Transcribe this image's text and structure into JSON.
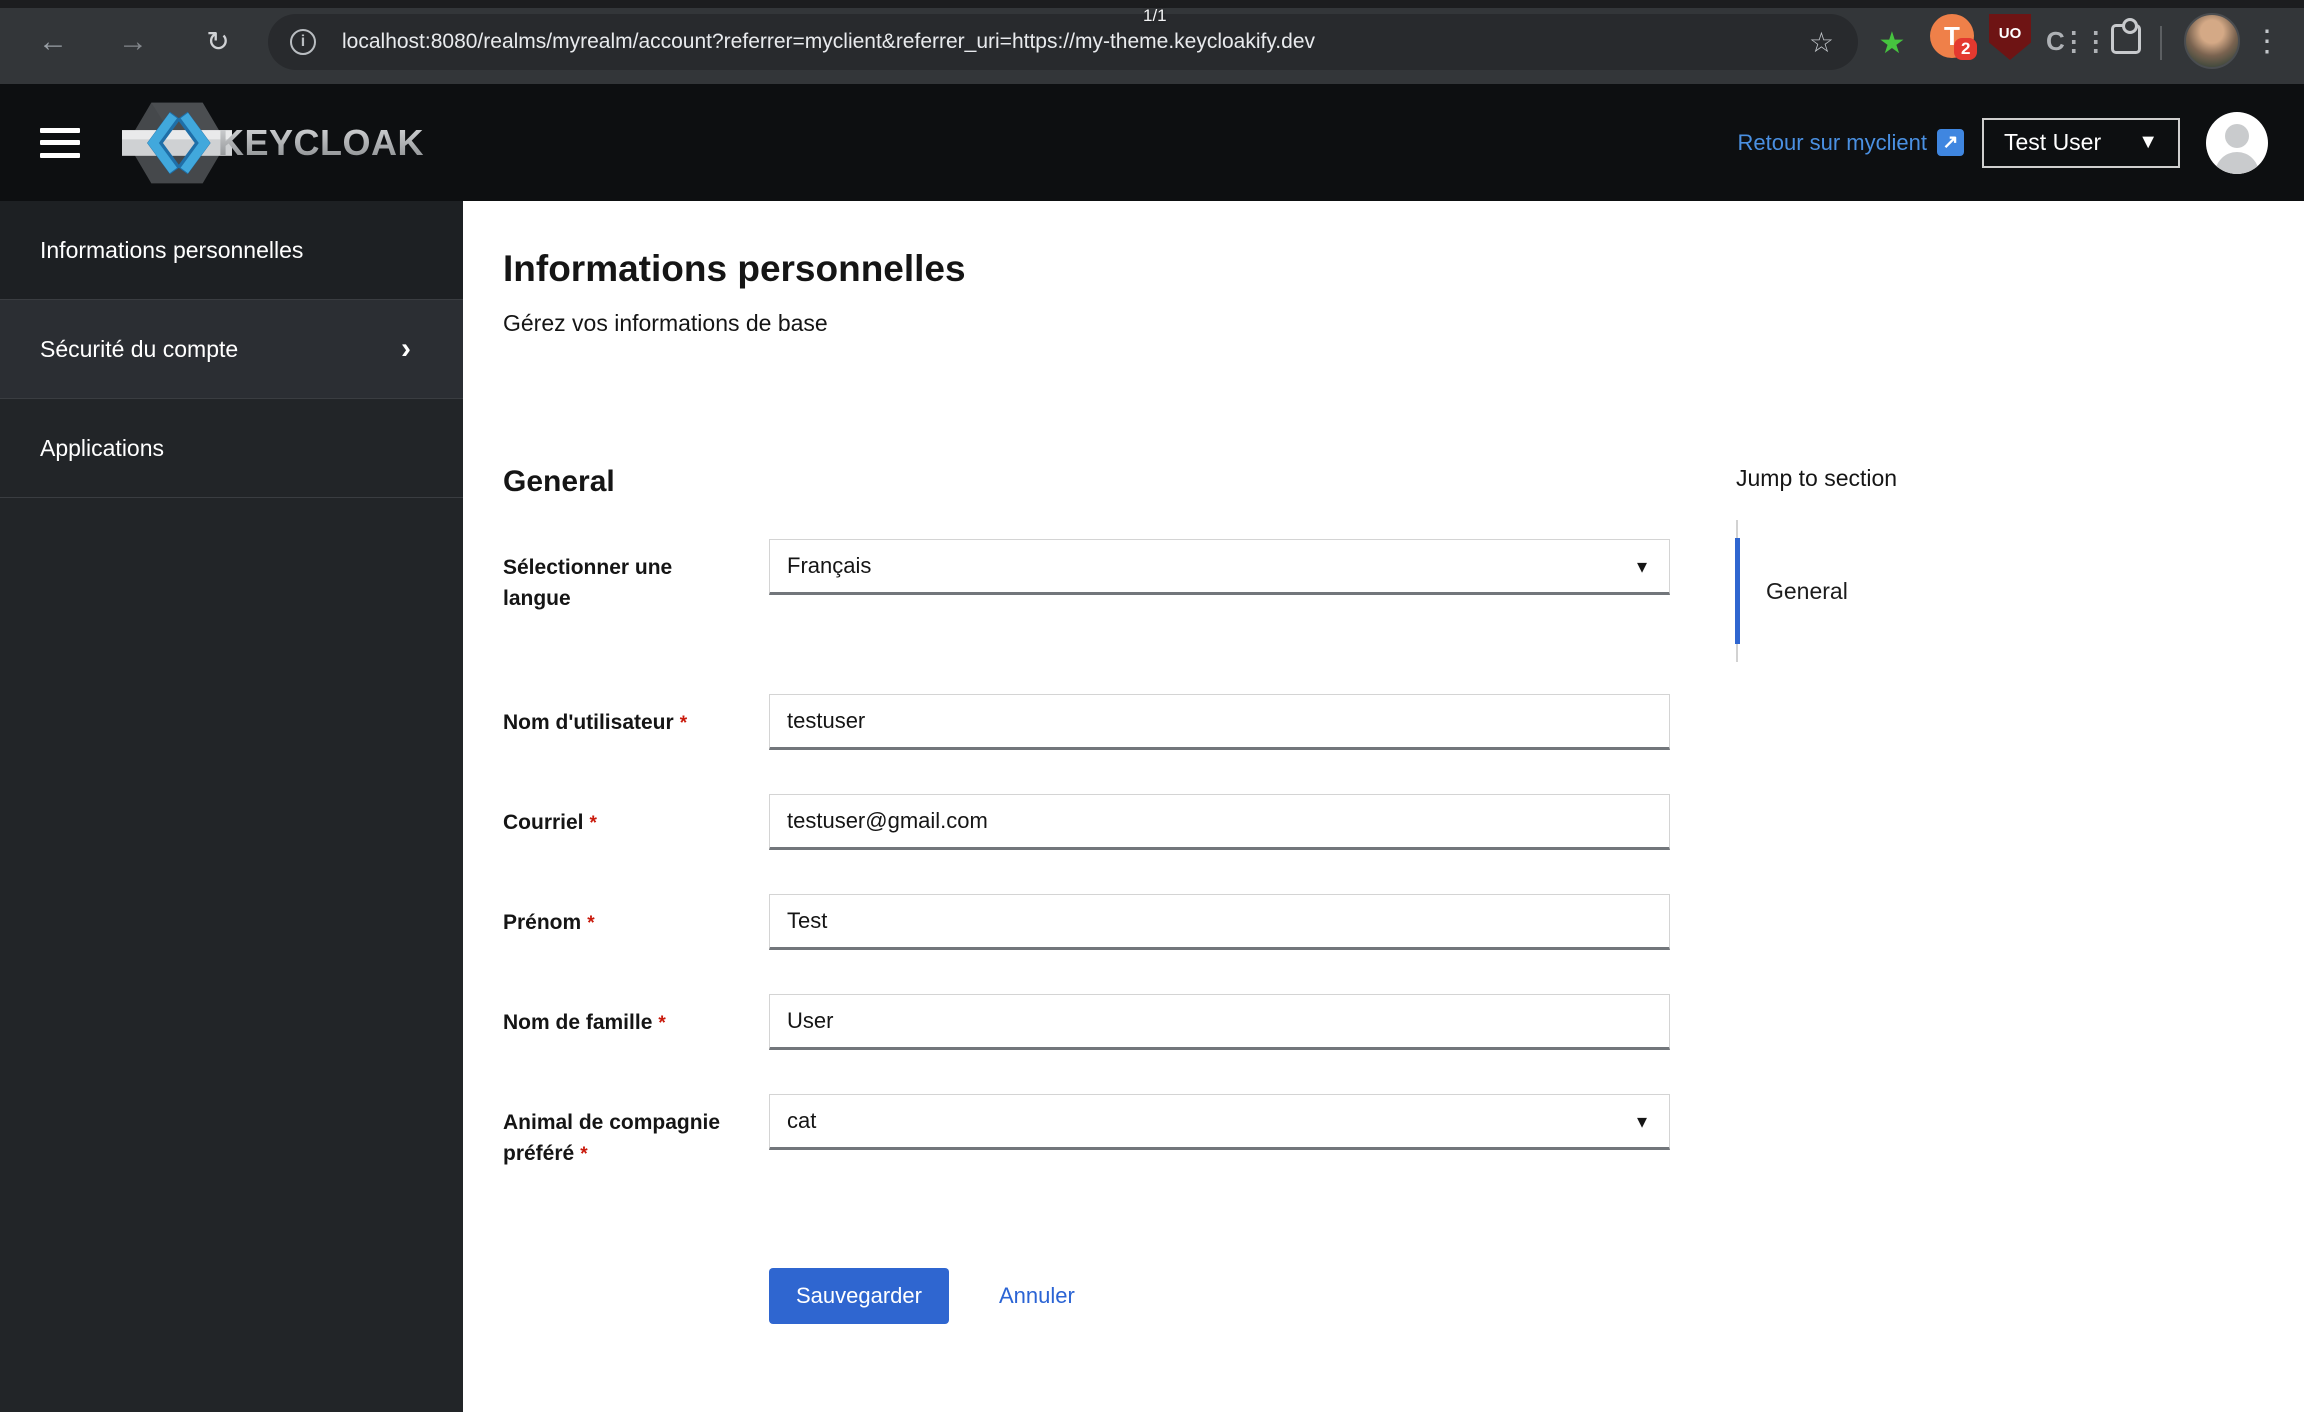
{
  "browser": {
    "url": "localhost:8080/realms/myrealm/account?referrer=myclient&referrer_uri=https://my-theme.keycloakify.dev",
    "page_counter": "1/1",
    "extension_badge": "2"
  },
  "icons": {
    "back": "←",
    "forward": "→",
    "reload": "↻",
    "info": "i",
    "bookmark_star": "☆",
    "ext_green_star": "★",
    "ext_t": "T",
    "ext_shield": "UO",
    "ext_c": "C⋮⋮",
    "kebab": "⋮",
    "caret_down": "▾",
    "dropdown_caret": "▼",
    "chevron_right": "›",
    "external_link": "↗",
    "required": "*"
  },
  "masthead": {
    "brand": "KEYCLOAK",
    "referrer_link": "Retour sur myclient",
    "user_menu": "Test User"
  },
  "sidebar": {
    "items": [
      {
        "label": "Informations personnelles"
      },
      {
        "label": "Sécurité du compte"
      },
      {
        "label": "Applications"
      }
    ]
  },
  "page": {
    "title": "Informations personnelles",
    "subtitle": "Gérez vos informations de base",
    "section_heading": "General",
    "jump": {
      "heading": "Jump to section",
      "items": [
        {
          "label": "General"
        }
      ]
    },
    "form": {
      "fields": [
        {
          "label": "Sélectionner une langue",
          "type": "select",
          "value": "Français",
          "required": false
        },
        {
          "label": "Nom d'utilisateur",
          "type": "text",
          "value": "testuser",
          "required": true
        },
        {
          "label": "Courriel",
          "type": "text",
          "value": "testuser@gmail.com",
          "required": true
        },
        {
          "label": "Prénom",
          "type": "text",
          "value": "Test",
          "required": true
        },
        {
          "label": "Nom de famille",
          "type": "text",
          "value": "User",
          "required": true
        },
        {
          "label": "Animal de compagnie préféré",
          "type": "select",
          "value": "cat",
          "required": true
        }
      ],
      "save_label": "Sauvegarder",
      "cancel_label": "Annuler"
    }
  },
  "colors": {
    "accent_blue": "#2f66d0",
    "masthead_link_blue": "#4a90e2",
    "required_red": "#c9190b",
    "sidebar_bg": "#222528",
    "masthead_bg": "#0d0f11"
  }
}
